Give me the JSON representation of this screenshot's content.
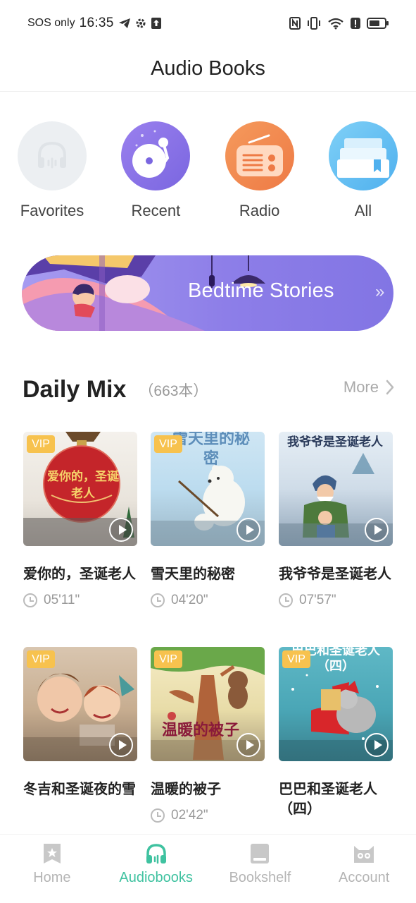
{
  "status_bar": {
    "carrier": "SOS only",
    "time": "16:35"
  },
  "header": {
    "title": "Audio Books"
  },
  "categories": [
    {
      "label": "Favorites",
      "icon": "headphones-icon"
    },
    {
      "label": "Recent",
      "icon": "record-player-icon"
    },
    {
      "label": "Radio",
      "icon": "radio-icon"
    },
    {
      "label": "All",
      "icon": "books-stack-icon"
    }
  ],
  "banner": {
    "label": "Bedtime Stories",
    "arrow": "»"
  },
  "daily_mix": {
    "title": "Daily Mix",
    "count": "（663本）",
    "more": "More"
  },
  "books": [
    {
      "title": "爱你的，圣诞老人",
      "duration": "05'11\"",
      "badge": "VIP",
      "cover_text": "爱你的，圣诞老人"
    },
    {
      "title": "雪天里的秘密",
      "duration": "04'20\"",
      "badge": "VIP",
      "cover_text": "雪天里的秘密"
    },
    {
      "title": "我爷爷是圣诞老人",
      "duration": "07'57\"",
      "badge": "",
      "cover_text": "我爷爷是圣诞老人"
    },
    {
      "title": "冬吉和圣诞夜的雪",
      "duration": "",
      "badge": "VIP",
      "cover_text": ""
    },
    {
      "title": "温暖的被子",
      "duration": "02'42\"",
      "badge": "VIP",
      "cover_text": "温暖的被子"
    },
    {
      "title": "巴巴和圣诞老人（四）",
      "duration": "",
      "badge": "VIP",
      "cover_text": "巴巴和圣诞老人（四）"
    }
  ],
  "bottom_nav": [
    {
      "label": "Home",
      "icon": "home-star-icon",
      "active": false
    },
    {
      "label": "Audiobooks",
      "icon": "headphones-icon",
      "active": true
    },
    {
      "label": "Bookshelf",
      "icon": "bookshelf-icon",
      "active": false
    },
    {
      "label": "Account",
      "icon": "cat-face-icon",
      "active": false
    }
  ],
  "colors": {
    "accent": "#3fc2a0",
    "vip": "#f7c24e",
    "banner": "#8d7ee8"
  }
}
